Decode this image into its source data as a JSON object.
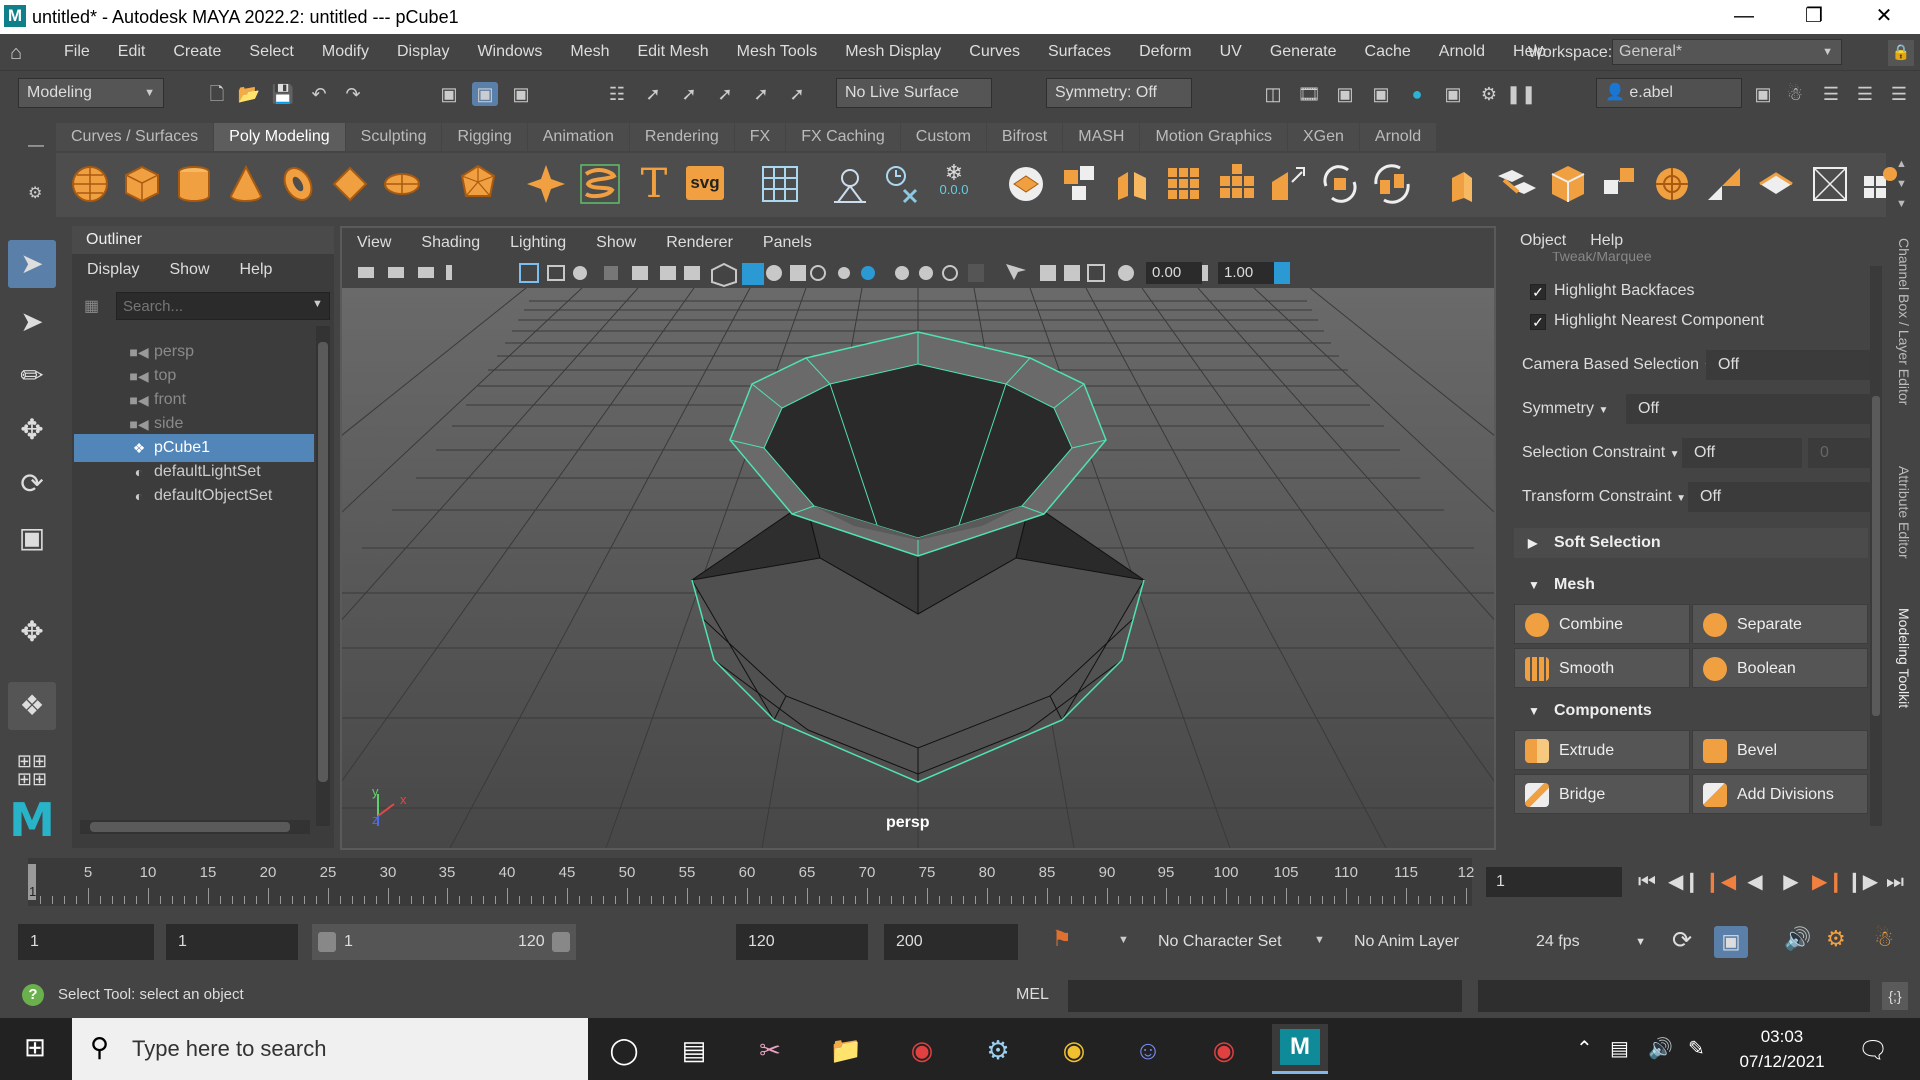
{
  "window": {
    "app_icon_letter": "M",
    "title": "untitled* - Autodesk MAYA 2022.2: untitled   ---   pCube1",
    "controls": [
      "minimize-icon",
      "restore-icon",
      "close-icon"
    ]
  },
  "menubar": {
    "items": [
      "File",
      "Edit",
      "Create",
      "Select",
      "Modify",
      "Display",
      "Windows",
      "Mesh",
      "Edit Mesh",
      "Mesh Tools",
      "Mesh Display",
      "Curves",
      "Surfaces",
      "Deform",
      "UV",
      "Generate",
      "Cache",
      "Arnold",
      "Help"
    ],
    "workspace_label": "Workspace:",
    "workspace_value": "General*"
  },
  "statusline": {
    "menuset": "Modeling",
    "live_surface": "No Live Surface",
    "symmetry": "Symmetry: Off",
    "user": "e.abel"
  },
  "shelf": {
    "tabs": [
      "Curves / Surfaces",
      "Poly Modeling",
      "Sculpting",
      "Rigging",
      "Animation",
      "Rendering",
      "FX",
      "FX Caching",
      "Custom",
      "Bifrost",
      "MASH",
      "Motion Graphics",
      "XGen",
      "Arnold"
    ],
    "active_tab": "Poly Modeling",
    "svg_label": "svg",
    "value_readout": "0.0.0"
  },
  "outliner": {
    "title": "Outliner",
    "menu": [
      "Display",
      "Show",
      "Help"
    ],
    "search_placeholder": "Search...",
    "items": [
      {
        "label": "persp",
        "icon": "camera-icon",
        "dim": true
      },
      {
        "label": "top",
        "icon": "camera-icon",
        "dim": true
      },
      {
        "label": "front",
        "icon": "camera-icon",
        "dim": true
      },
      {
        "label": "side",
        "icon": "camera-icon",
        "dim": true
      },
      {
        "label": "pCube1",
        "icon": "mesh-icon",
        "selected": true
      },
      {
        "label": "defaultLightSet",
        "icon": "set-icon"
      },
      {
        "label": "defaultObjectSet",
        "icon": "set-icon"
      }
    ]
  },
  "viewport": {
    "menu": [
      "View",
      "Shading",
      "Lighting",
      "Show",
      "Renderer",
      "Panels"
    ],
    "exposure": "0.00",
    "gamma": "1.00",
    "camera": "persp",
    "axis_x": "x",
    "axis_y": "y",
    "axis_z": "z"
  },
  "modeling_toolkit": {
    "menu": [
      "Object",
      "Help"
    ],
    "truncated_option": "Tweak/Marquee",
    "checks": [
      {
        "label": "Highlight Backfaces",
        "checked": true
      },
      {
        "label": "Highlight Nearest Component",
        "checked": true
      }
    ],
    "options": [
      {
        "label": "Camera Based Selection",
        "value": "Off"
      },
      {
        "label": "Symmetry",
        "value": "Off"
      },
      {
        "label": "Selection Constraint",
        "value": "Off",
        "extra": "0"
      },
      {
        "label": "Transform Constraint",
        "value": "Off"
      }
    ],
    "soft_selection": "Soft Selection",
    "mesh_section": "Mesh",
    "mesh_buttons": [
      "Combine",
      "Separate",
      "Smooth",
      "Boolean"
    ],
    "components_section": "Components",
    "component_buttons": [
      "Extrude",
      "Bevel",
      "Bridge",
      "Add Divisions"
    ],
    "side_tabs": [
      "Channel Box / Layer Editor",
      "Attribute Editor",
      "Modeling Toolkit"
    ]
  },
  "timeslider": {
    "ticks": [
      "5",
      "10",
      "15",
      "20",
      "25",
      "30",
      "35",
      "40",
      "45",
      "50",
      "55",
      "60",
      "65",
      "70",
      "75",
      "80",
      "85",
      "90",
      "95",
      "100",
      "105",
      "110",
      "115",
      "12"
    ],
    "start_marker": "1",
    "current_frame": "1"
  },
  "range": {
    "start": "1",
    "playback_start": "1",
    "slider_start": "1",
    "slider_end": "120",
    "playback_end": "120",
    "end": "200",
    "character_set": "No Character Set",
    "anim_layer": "No Anim Layer",
    "fps": "24 fps"
  },
  "commandline": {
    "help_line": "Select Tool: select an object",
    "language": "MEL"
  },
  "taskbar": {
    "search_placeholder": "Type here to search",
    "time": "03:03",
    "date": "07/12/2021"
  }
}
